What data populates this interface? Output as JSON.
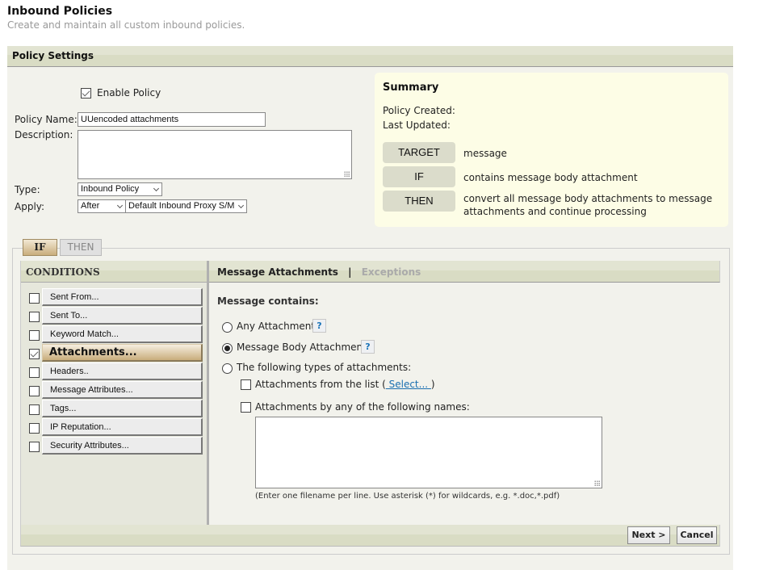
{
  "page": {
    "title": "Inbound Policies",
    "subtitle": "Create and maintain all custom inbound policies."
  },
  "settings": {
    "header": "Policy Settings",
    "enable_policy_label": "Enable Policy",
    "enable_policy_checked": true,
    "policy_name_label": "Policy Name:",
    "policy_name_value": "UUencoded attachments",
    "description_label": "Description:",
    "description_value": "",
    "type_label": "Type:",
    "type_value": "Inbound Policy",
    "apply_label": "Apply:",
    "apply_position_value": "After",
    "apply_policy_value": "Default Inbound Proxy S/M"
  },
  "summary": {
    "title": "Summary",
    "created_label": "Policy Created:",
    "created_value": "",
    "updated_label": "Last Updated:",
    "updated_value": "",
    "rows": [
      {
        "badge": "TARGET",
        "text": "message"
      },
      {
        "badge": "IF",
        "text": "contains message body attachment"
      },
      {
        "badge": "THEN",
        "text": "convert all message body attachments to message attachments and continue processing"
      }
    ]
  },
  "tabs": {
    "if_label": "IF",
    "then_label": "THEN",
    "active": "IF"
  },
  "conditions": {
    "header": "CONDITIONS",
    "items": [
      {
        "label": "Sent From...",
        "checked": false,
        "active": false
      },
      {
        "label": "Sent To...",
        "checked": false,
        "active": false
      },
      {
        "label": "Keyword Match...",
        "checked": false,
        "active": false
      },
      {
        "label": "Attachments...",
        "checked": true,
        "active": true
      },
      {
        "label": "Headers..",
        "checked": false,
        "active": false
      },
      {
        "label": "Message Attributes...",
        "checked": false,
        "active": false
      },
      {
        "label": "Tags...",
        "checked": false,
        "active": false
      },
      {
        "label": "IP Reputation...",
        "checked": false,
        "active": false
      },
      {
        "label": "Security Attributes...",
        "checked": false,
        "active": false
      }
    ]
  },
  "detail": {
    "tab_active": "Message Attachments",
    "tab_separator": "|",
    "tab_inactive": "Exceptions",
    "section_label": "Message contains:",
    "options": {
      "any_attachment": "Any Attachment",
      "message_body_attachment": "Message Body Attachment",
      "following_types": "The following types of attachments:",
      "selected": "message_body_attachment"
    },
    "help_glyph": "?",
    "from_list_prefix": "Attachments from the list (",
    "from_list_link": " Select... ",
    "from_list_suffix": ")",
    "by_names_label": "Attachments by any of the following names:",
    "names_value": "",
    "hint": "(Enter one filename per line. Use asterisk (*) for wildcards, e.g. *.doc,*.pdf)"
  },
  "footer": {
    "next_label": "Next >",
    "cancel_label": "Cancel"
  }
}
